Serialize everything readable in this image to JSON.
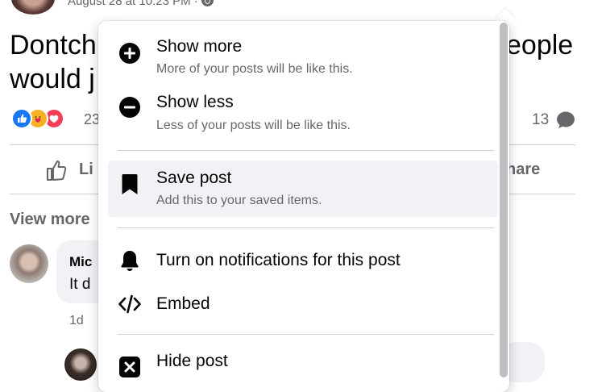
{
  "post": {
    "meta": "August 28 at 10:23 PM ·",
    "text_line1": "Dontch",
    "text_line1_right": "eople",
    "text_line2": "would j",
    "reaction_count": "23",
    "comment_count": "13",
    "like_label": "Li",
    "share_label": "hare",
    "view_more": "View more"
  },
  "comment": {
    "name": "Mic",
    "text": "It d",
    "time": "1d"
  },
  "menu": {
    "items": [
      {
        "title": "Show more",
        "subtitle": "More of your posts will be like this.",
        "icon": "plus-circle-icon"
      },
      {
        "title": "Show less",
        "subtitle": "Less of your posts will be like this.",
        "icon": "minus-circle-icon"
      },
      {
        "title": "Save post",
        "subtitle": "Add this to your saved items.",
        "icon": "bookmark-icon"
      },
      {
        "title": "Turn on notifications for this post",
        "icon": "bell-icon"
      },
      {
        "title": "Embed",
        "icon": "code-icon"
      },
      {
        "title": "Hide post",
        "icon": "close-box-icon"
      }
    ]
  },
  "colors": {
    "text_primary": "#050505",
    "text_secondary": "#65676b",
    "hover_bg": "#f0f2f5",
    "divider": "#ced0d4",
    "like_blue": "#1877f2",
    "love_red": "#f33e58",
    "care_yellow": "#f7b125"
  }
}
